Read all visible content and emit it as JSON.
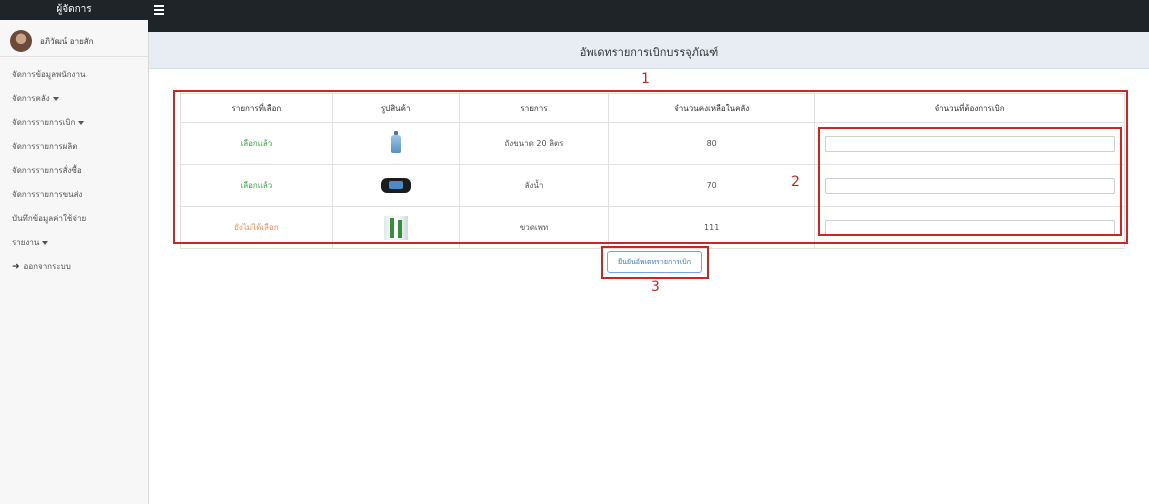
{
  "sidebar": {
    "header": "ผู้จัดการ",
    "user_name": "อภิวัฒน์ อายสัก",
    "menu": [
      {
        "label": "จัดการข้อมูลพนักงาน",
        "caret": false
      },
      {
        "label": "จัดการคลัง",
        "caret": true
      },
      {
        "label": "จัดการรายการเบิก",
        "caret": true
      },
      {
        "label": "จัดการรายการผลิต",
        "caret": false
      },
      {
        "label": "จัดการรายการสั่งซื้อ",
        "caret": false
      },
      {
        "label": "จัดการรายการขนส่ง",
        "caret": false
      },
      {
        "label": "บันทึกข้อมูลค่าใช้จ่าย",
        "caret": false
      },
      {
        "label": "รายงาน",
        "caret": true
      }
    ],
    "logout": "ออกจากระบบ"
  },
  "page": {
    "title": "อัพเดทรายการเบิกบรรจุภัณฑ์"
  },
  "table": {
    "headers": [
      "รายการที่เลือก",
      "รูปสินค้า",
      "รายการ",
      "จำนวนคงเหลือในคลัง",
      "จำนวนที่ต้องการเบิก"
    ],
    "rows": [
      {
        "status": "เลือกแล้ว",
        "status_type": "selected",
        "image_icon": "water-bottle-icon",
        "item": "ถังขนาด 20 ลิตร",
        "stock": "80",
        "qty_value": ""
      },
      {
        "status": "เลือกแล้ว",
        "status_type": "selected",
        "image_icon": "crate-icon",
        "item": "ลังน้ำ",
        "stock": "70",
        "qty_value": ""
      },
      {
        "status": "ยังไม่ได้เลือก",
        "status_type": "not-selected",
        "image_icon": "pet-bottle-icon",
        "item": "ขวดเพท",
        "stock": "111",
        "qty_value": ""
      }
    ]
  },
  "confirm_button": "ยืนยันอัพเดทรายการเบิก",
  "annotations": [
    "1",
    "2",
    "3"
  ],
  "colors": {
    "topbar": "#1f2429",
    "selected": "#3aa24a",
    "not_selected": "#ef8d56",
    "annotation": "#c62828",
    "button_text": "#3a79c2"
  }
}
